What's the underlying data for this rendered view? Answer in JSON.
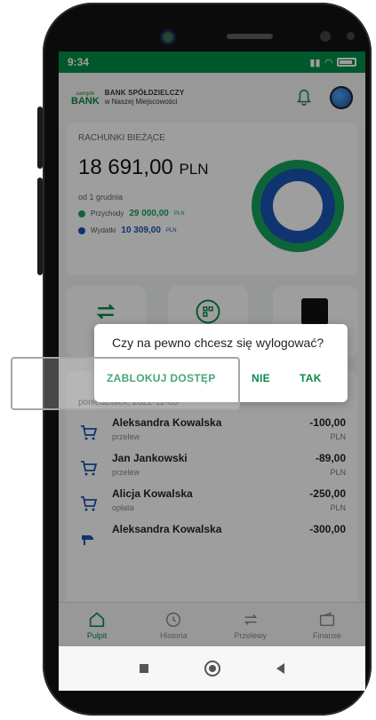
{
  "statusbar": {
    "time": "9:34",
    "signal": "⁵⁶ᴵˡ",
    "wifi": "≋"
  },
  "header": {
    "logo_mark_top": "sample",
    "logo_mark": "BANK",
    "bank_name": "BANK SPÓŁDZIELCZY",
    "bank_sub": "w Naszej Miejscowości"
  },
  "account": {
    "label": "RACHUNKI BIEŻĄCE",
    "balance_value": "18 691,00",
    "balance_currency": "PLN",
    "since": "od 1 grudnia",
    "income_label": "Przychody",
    "income_value": "29 000,00",
    "income_currency": "PLN",
    "expense_label": "Wydatki",
    "expense_value": "10 309,00",
    "expense_currency": "PLN"
  },
  "colors": {
    "brand": "#008e47",
    "income": "#17a25d",
    "expense": "#1a54b3"
  },
  "transactions": {
    "date": "poniedziałek, 2022-12-05",
    "items": [
      {
        "name": "Aleksandra Kowalska",
        "type": "przelew",
        "amount": "-100,00",
        "currency": "PLN",
        "icon": "cart-icon"
      },
      {
        "name": "Jan Jankowski",
        "type": "przelew",
        "amount": "-89,00",
        "currency": "PLN",
        "icon": "cart-icon"
      },
      {
        "name": "Alicja Kowalska",
        "type": "opłata",
        "amount": "-250,00",
        "currency": "PLN",
        "icon": "cart-icon"
      },
      {
        "name": "Aleksandra Kowalska",
        "type": "",
        "amount": "-300,00",
        "currency": "",
        "icon": "fuel-icon"
      }
    ]
  },
  "dialog": {
    "question": "Czy na pewno chcesz się wylogować?",
    "block_label": "ZABLOKUJ DOSTĘP",
    "no_label": "NIE",
    "yes_label": "TAK"
  },
  "nav": {
    "items": [
      {
        "label": "Pulpit",
        "active": true
      },
      {
        "label": "Historia",
        "active": false
      },
      {
        "label": "Przelewy",
        "active": false
      },
      {
        "label": "Finanse",
        "active": false
      }
    ]
  }
}
